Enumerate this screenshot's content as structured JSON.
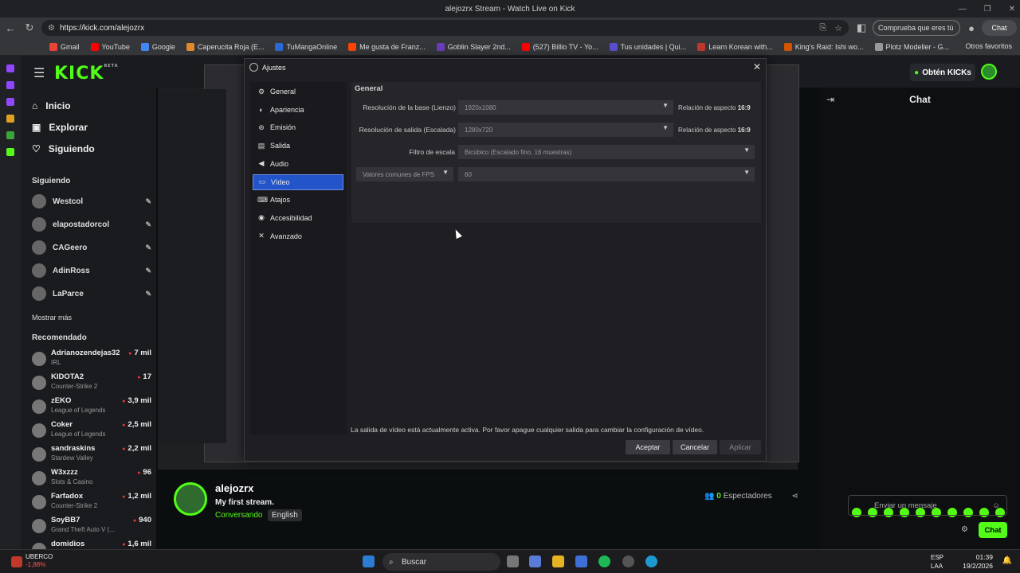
{
  "browser": {
    "window_title": "alejozrx Stream - Watch Live on Kick",
    "url": "https://kick.com/alejozrx",
    "profile_chip": "Comprueba que eres tú",
    "chat_chip": "Chat",
    "other_favorites": "Otros favoritos",
    "bookmarks": [
      {
        "label": "Gmail",
        "color": "#ea4335"
      },
      {
        "label": "YouTube",
        "color": "#ff0000"
      },
      {
        "label": "Google",
        "color": "#4285f4"
      },
      {
        "label": "Caperucita Roja (E...",
        "color": "#e08a2e"
      },
      {
        "label": "TuMangaOnline",
        "color": "#2d6ad6"
      },
      {
        "label": "Me gusta de Franz...",
        "color": "#ff4500"
      },
      {
        "label": "Goblin Slayer 2nd...",
        "color": "#6a3dbb"
      },
      {
        "label": "(527) Billio TV - Yo...",
        "color": "#ff0000"
      },
      {
        "label": "Tus unidades | Qui...",
        "color": "#5a4fcf"
      },
      {
        "label": "Learn Korean with...",
        "color": "#c0392b"
      },
      {
        "label": "King's Raid: Ishi wo...",
        "color": "#d35400"
      },
      {
        "label": "Plotz Modeller - G...",
        "color": "#999999"
      }
    ]
  },
  "kick": {
    "get_kicks": "Obtén KICKs",
    "nav": [
      "Inicio",
      "Explorar",
      "Siguiendo"
    ],
    "following_title": "Siguiendo",
    "following": [
      "Westcol",
      "elapostadorcol",
      "CAGeero",
      "AdinRoss",
      "LaParce"
    ],
    "show_more": "Mostrar más",
    "recommended_title": "Recomendado",
    "recommended": [
      {
        "name": "Adrianozendejas32",
        "game": "IRL",
        "viewers": "7 mil"
      },
      {
        "name": "KIDOTA2",
        "game": "Counter-Strike 2",
        "viewers": "17"
      },
      {
        "name": "zEKO",
        "game": "League of Legends",
        "viewers": "3,9 mil"
      },
      {
        "name": "Coker",
        "game": "League of Legends",
        "viewers": "2,5 mil"
      },
      {
        "name": "sandraskins",
        "game": "Stardew Valley",
        "viewers": "2,2 mil"
      },
      {
        "name": "W3xzzz",
        "game": "Slots & Casino",
        "viewers": "96"
      },
      {
        "name": "Farfadox",
        "game": "Counter-Strike 2",
        "viewers": "1,2 mil"
      },
      {
        "name": "SoyBB7",
        "game": "Grand Theft Auto V (...",
        "viewers": "940"
      },
      {
        "name": "domidios",
        "game": "",
        "viewers": "1,6 mil"
      }
    ],
    "channel": {
      "name": "alejozrx",
      "title": "My first stream.",
      "category": "Conversando",
      "language": "English",
      "viewers_count": "0",
      "viewers_label": "Espectadores"
    },
    "chat": {
      "title": "Chat",
      "placeholder": "Enviar un mensaje",
      "send_label": "Chat"
    }
  },
  "dialog": {
    "title": "Ajustes",
    "categories": [
      {
        "label": "General",
        "icon": "gear-icon"
      },
      {
        "label": "Apariencia",
        "icon": "palette-icon"
      },
      {
        "label": "Emisión",
        "icon": "broadcast-icon"
      },
      {
        "label": "Salida",
        "icon": "output-icon"
      },
      {
        "label": "Audio",
        "icon": "speaker-icon"
      },
      {
        "label": "Vídeo",
        "icon": "monitor-icon"
      },
      {
        "label": "Atajos",
        "icon": "keyboard-icon"
      },
      {
        "label": "Accesibilidad",
        "icon": "accessibility-icon"
      },
      {
        "label": "Avanzado",
        "icon": "tools-icon"
      }
    ],
    "selected_category": "Vídeo",
    "section_title": "General",
    "base_res_label": "Resolución de la base (Lienzo)",
    "base_res_value": "1920x1080",
    "output_res_label": "Resolución de salida (Escalada)",
    "output_res_value": "1280x720",
    "aspect_label": "Relación de aspecto",
    "aspect_value": "16:9",
    "filter_label": "Filtro de escala",
    "filter_value": "Bicúbico (Escalado fino, 16 muestras)",
    "fps_type": "Valores comunes de FPS",
    "fps_value": "60",
    "warning": "La salida de vídeo está actualmente activa. Por favor apague cualquier salida para cambiar la configuración de vídeo.",
    "ok": "Aceptar",
    "cancel": "Cancelar",
    "apply": "Aplicar"
  },
  "taskbar": {
    "ticker_name": "UBERCO",
    "ticker_change": "-1,88%",
    "search": "Buscar",
    "lang1": "ESP",
    "lang2": "LAA",
    "time": "01:39",
    "date": "19/2/2026"
  }
}
